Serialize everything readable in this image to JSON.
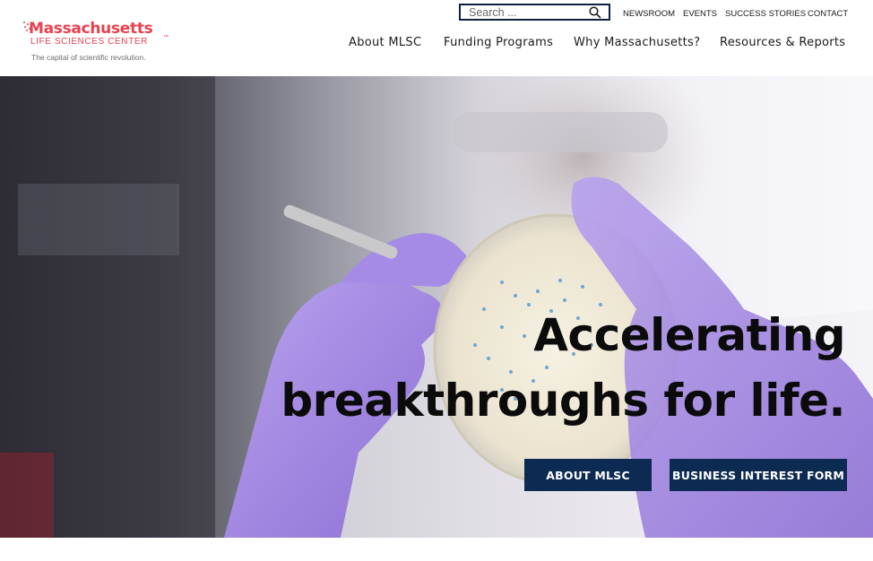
{
  "header": {
    "logo": {
      "main": "Massachusetts",
      "sub": "LIFE SCIENCES CENTER",
      "tagline": "The capital of scientific revolution."
    },
    "search": {
      "placeholder": "Search ..."
    },
    "utility_nav": [
      "NEWSROOM",
      "EVENTS",
      "SUCCESS STORIES",
      "CONTACT"
    ],
    "main_nav": [
      "About MLSC",
      "Funding Programs",
      "Why Massachusetts?",
      "Resources & Reports"
    ]
  },
  "hero": {
    "headline_line1": "Accelerating",
    "headline_line2": "breakthroughs for life.",
    "buttons": [
      "ABOUT MLSC",
      "BUSINESS INTEREST FORM"
    ]
  },
  "colors": {
    "brand_red": "#e8414e",
    "navy": "#0d2a52",
    "glove_purple": "#a98fe0"
  }
}
